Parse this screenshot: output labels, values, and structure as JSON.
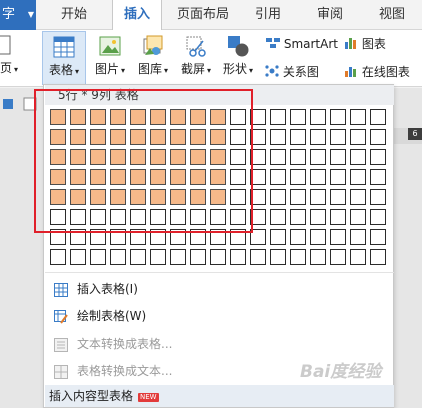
{
  "app_button": {
    "label": "字"
  },
  "tabs": [
    {
      "label": "开始"
    },
    {
      "label": "插入"
    },
    {
      "label": "页面布局"
    },
    {
      "label": "引用"
    },
    {
      "label": "审阅"
    },
    {
      "label": "视图"
    }
  ],
  "active_tab": "插入",
  "ribbon": {
    "left_partial": "页",
    "table": "表格",
    "picture": "图片",
    "gallery": "图库",
    "screenshot": "截屏",
    "shapes": "形状",
    "relation": "关系图",
    "smartart": "SmartArt",
    "chart": "图表",
    "online_chart": "在线图表"
  },
  "ruler_mark": "6",
  "table_picker": {
    "title": "5行 * 9列 表格",
    "rows_selected": 5,
    "cols_selected": 9,
    "total_rows": 8,
    "total_cols": 17
  },
  "menu": {
    "insert_table": "插入表格(I)",
    "draw_table": "绘制表格(W)",
    "text_to_table": "文本转换成表格...",
    "table_to_text": "表格转换成文本...",
    "insert_content_table": "插入内容型表格",
    "new_badge": "NEW"
  },
  "watermark": "Bai度经验",
  "colors": {
    "accent": "#2f6fbd",
    "selected_cell": "#f6b98a",
    "highlight_box": "#e0202a"
  }
}
